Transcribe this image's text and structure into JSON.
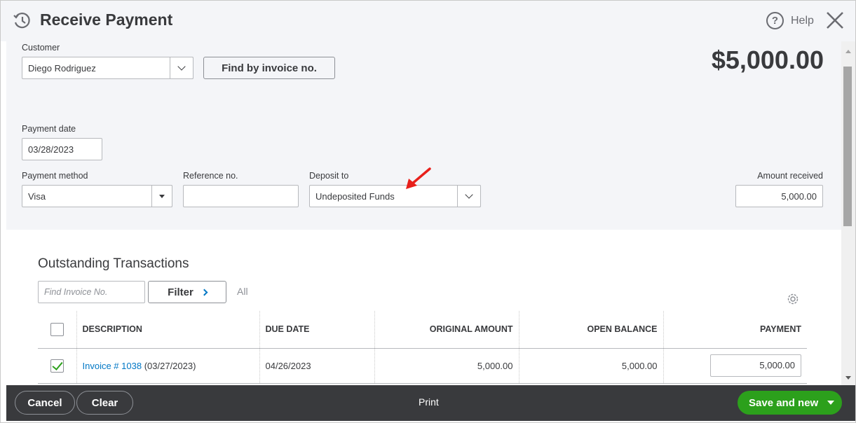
{
  "header": {
    "title": "Receive Payment",
    "help_label": "Help"
  },
  "customer": {
    "label": "Customer",
    "value": "Diego Rodriguez",
    "find_button": "Find by invoice no."
  },
  "amount_display": "$5,000.00",
  "payment_date": {
    "label": "Payment date",
    "value": "03/28/2023"
  },
  "payment_method": {
    "label": "Payment method",
    "value": "Visa"
  },
  "reference": {
    "label": "Reference no.",
    "value": ""
  },
  "deposit_to": {
    "label": "Deposit to",
    "value": "Undeposited Funds"
  },
  "amount_received": {
    "label": "Amount received",
    "value": "5,000.00"
  },
  "outstanding": {
    "title": "Outstanding Transactions",
    "find_placeholder": "Find Invoice No.",
    "filter_label": "Filter",
    "all_label": "All",
    "columns": [
      "DESCRIPTION",
      "DUE DATE",
      "ORIGINAL AMOUNT",
      "OPEN BALANCE",
      "PAYMENT"
    ],
    "rows": [
      {
        "checked": true,
        "invoice_link": "Invoice # 1038",
        "invoice_date": "(03/27/2023)",
        "due_date": "04/26/2023",
        "original_amount": "5,000.00",
        "open_balance": "5,000.00",
        "payment": "5,000.00"
      }
    ]
  },
  "footer": {
    "cancel": "Cancel",
    "clear": "Clear",
    "print": "Print",
    "save": "Save and new"
  },
  "colors": {
    "primary_green": "#2ca01c",
    "link_blue": "#0077c5",
    "footer_bg": "#393a3d",
    "annotation_red": "#e8201b"
  }
}
